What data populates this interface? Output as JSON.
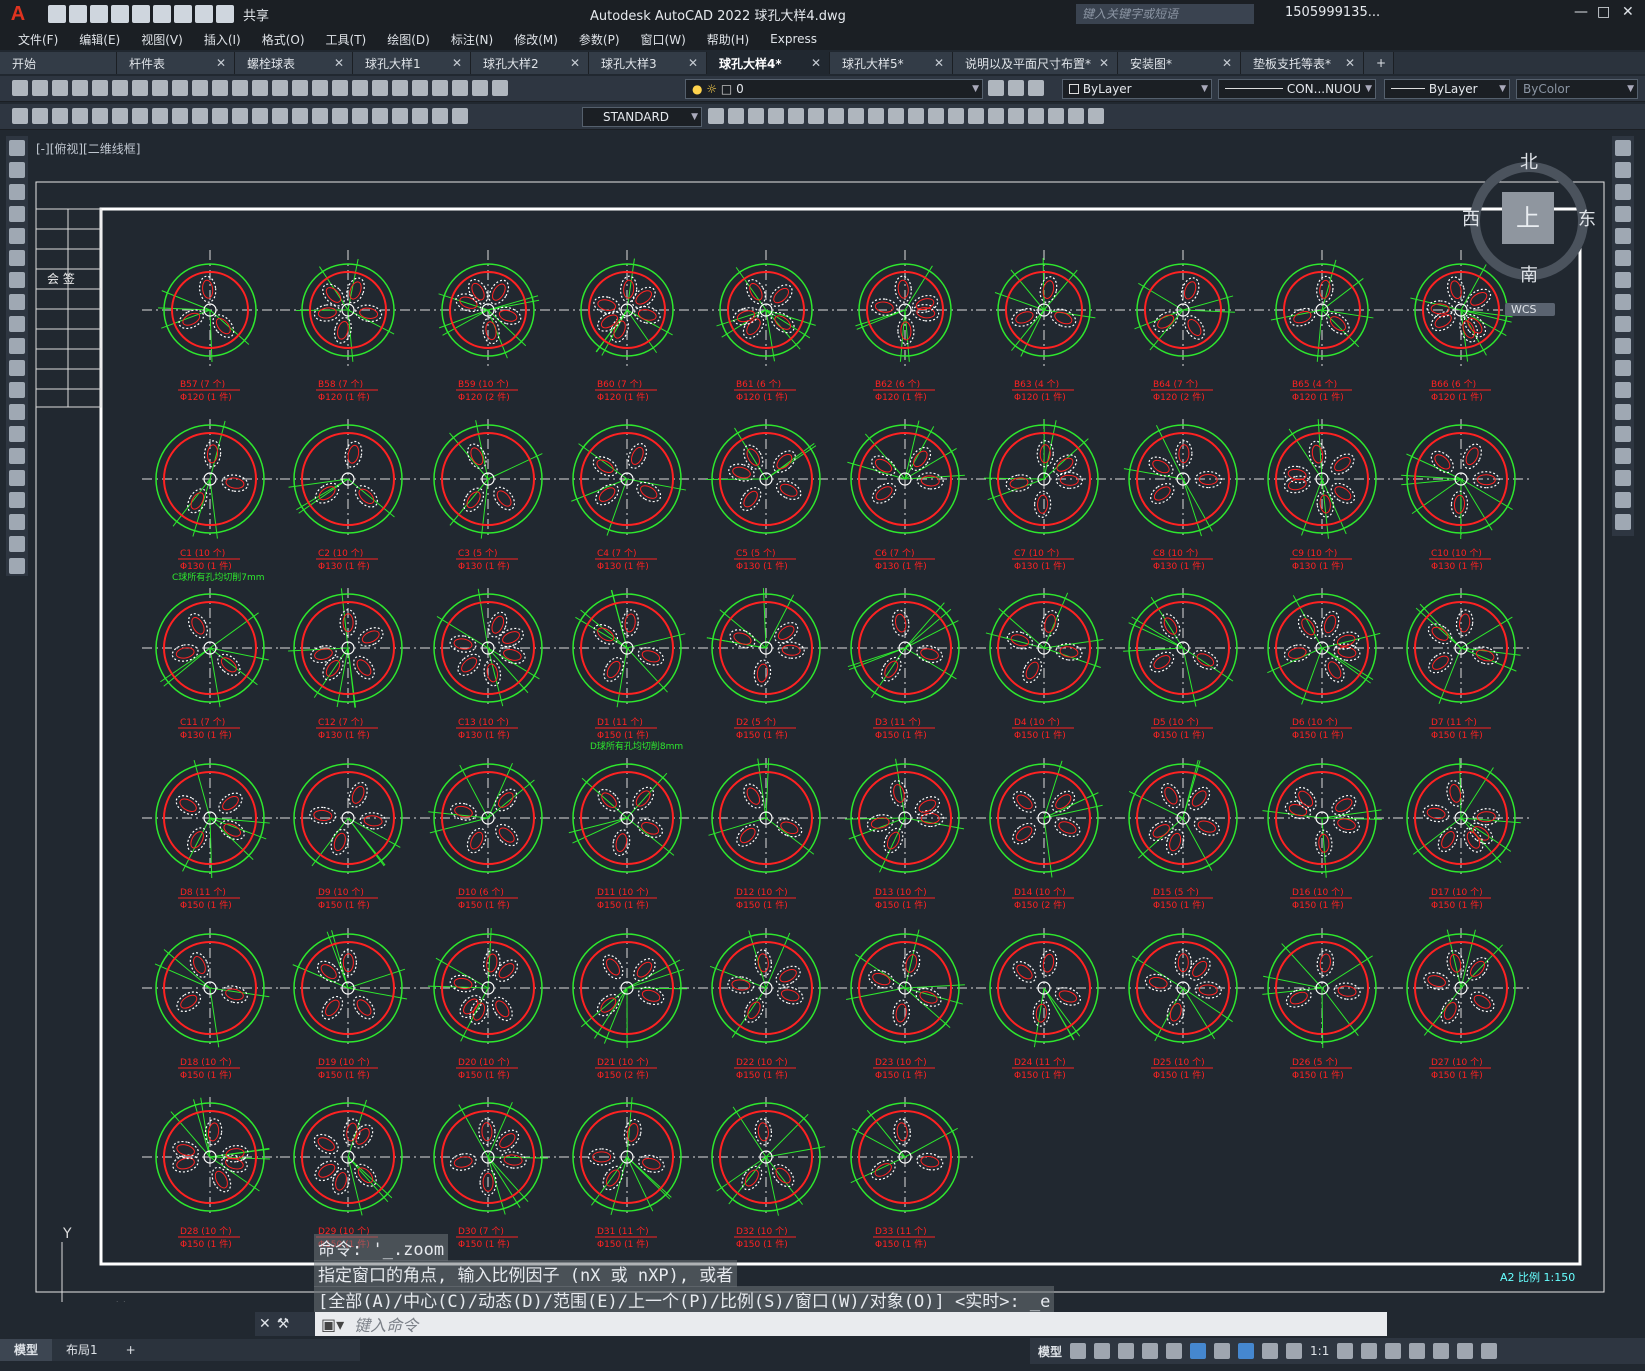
{
  "app": {
    "title": "Autodesk AutoCAD 2022    球孔大样4.dwg",
    "search_placeholder": "键入关键字或短语",
    "user": "1505999135...",
    "share": "共享"
  },
  "menu": [
    "文件(F)",
    "编辑(E)",
    "视图(V)",
    "插入(I)",
    "格式(O)",
    "工具(T)",
    "绘图(D)",
    "标注(N)",
    "修改(M)",
    "参数(P)",
    "窗口(W)",
    "帮助(H)",
    "Express"
  ],
  "tabs": [
    {
      "label": "开始",
      "active": false
    },
    {
      "label": "杆件表",
      "active": false
    },
    {
      "label": "螺栓球表",
      "active": false
    },
    {
      "label": "球孔大样1",
      "active": false
    },
    {
      "label": "球孔大样2",
      "active": false
    },
    {
      "label": "球孔大样3",
      "active": false
    },
    {
      "label": "球孔大样4*",
      "active": true
    },
    {
      "label": "球孔大样5*",
      "active": false
    },
    {
      "label": "说明以及平面尺寸布置*",
      "active": false
    },
    {
      "label": "安装图*",
      "active": false
    },
    {
      "label": "垫板支托等表*",
      "active": false
    }
  ],
  "toolbar": {
    "layer": "0",
    "color": "ByLayer",
    "linetype": "CON...NUOU",
    "lineweight": "ByLayer",
    "plotstyle": "ByColor",
    "textstyle": "STANDARD"
  },
  "view_label": "[-][俯视][二维线框]",
  "title_block_label": "会 签",
  "viewcube": {
    "north": "北",
    "south": "南",
    "west": "西",
    "east": "东",
    "face": "上",
    "wcs": "WCS"
  },
  "colors": {
    "ring": "#ff2222",
    "dimension": "#2ee82e",
    "holes": "#ffffff",
    "axis": "#dddddd"
  },
  "ball_labels": [
    [
      "B57 (7 个)",
      "B58 (7 个)",
      "B59 (10 个)",
      "B60 (7 个)",
      "B61 (6 个)",
      "B62 (6 个)",
      "B63 (4 个)",
      "B64 (7 个)",
      "B65 (4 个)",
      "B66 (6 个)"
    ],
    [
      "C1 (10 个)",
      "C2 (10 个)",
      "C3 (5 个)",
      "C4 (7 个)",
      "C5 (5 个)",
      "C6 (7 个)",
      "C7 (10 个)",
      "C8 (10 个)",
      "C9 (10 个)",
      "C10 (10 个)"
    ],
    [
      "C11 (7 个)",
      "C12 (7 个)",
      "C13 (10 个)",
      "D1 (11 个)",
      "D2 (5 个)",
      "D3 (11 个)",
      "D4 (10 个)",
      "D5 (10 个)",
      "D6 (10 个)",
      "D7 (11 个)"
    ],
    [
      "D8 (11 个)",
      "D9 (10 个)",
      "D10 (6 个)",
      "D11 (10 个)",
      "D12 (10 个)",
      "D13 (10 个)",
      "D14 (10 个)",
      "D15 (5 个)",
      "D16 (10 个)",
      "D17 (10 个)"
    ],
    [
      "D18 (10 个)",
      "D19 (10 个)",
      "D20 (10 个)",
      "D21 (10 个)",
      "D22 (10 个)",
      "D23 (10 个)",
      "D24 (11 个)",
      "D25 (10 个)",
      "D26 (5 个)",
      "D27 (10 个)"
    ],
    [
      "D28 (10 个)",
      "D29 (10 个)",
      "D30 (7 个)",
      "D31 (11 个)",
      "D32 (10 个)",
      "D33 (11 个)"
    ]
  ],
  "ball_sub_labels": [
    [
      "Φ120 (1 件)",
      "Φ120 (1 件)",
      "Φ120 (2 件)",
      "Φ120 (1 件)",
      "Φ120 (1 件)",
      "Φ120 (1 件)",
      "Φ120 (1 件)",
      "Φ120 (2 件)",
      "Φ120 (1 件)",
      "Φ120 (1 件)"
    ],
    [
      "Φ130 (1 件)",
      "Φ130 (1 件)",
      "Φ130 (1 件)",
      "Φ130 (1 件)",
      "Φ130 (1 件)",
      "Φ130 (1 件)",
      "Φ130 (1 件)",
      "Φ130 (1 件)",
      "Φ130 (1 件)",
      "Φ130 (1 件)"
    ],
    [
      "Φ130 (1 件)",
      "Φ130 (1 件)",
      "Φ130 (1 件)",
      "Φ150 (1 件)",
      "Φ150 (1 件)",
      "Φ150 (1 件)",
      "Φ150 (1 件)",
      "Φ150 (1 件)",
      "Φ150 (1 件)",
      "Φ150 (1 件)"
    ],
    [
      "Φ150 (1 件)",
      "Φ150 (1 件)",
      "Φ150 (1 件)",
      "Φ150 (1 件)",
      "Φ150 (1 件)",
      "Φ150 (1 件)",
      "Φ150 (2 件)",
      "Φ150 (1 件)",
      "Φ150 (1 件)",
      "Φ150 (1 件)"
    ],
    [
      "Φ150 (1 件)",
      "Φ150 (1 件)",
      "Φ150 (1 件)",
      "Φ150 (2 件)",
      "Φ150 (1 件)",
      "Φ150 (1 件)",
      "Φ150 (1 件)",
      "Φ150 (1 件)",
      "Φ150 (1 件)",
      "Φ150 (1 件)"
    ],
    [
      "Φ150 (1 件)",
      "Φ150 (1 件)",
      "Φ150 (1 件)",
      "Φ150 (1 件)",
      "Φ150 (1 件)",
      "Φ150 (1 件)"
    ]
  ],
  "notes": {
    "c_note": "C球所有孔均切削7mm",
    "d_note": "D球所有孔均切削8mm"
  },
  "scale_note": "A2 比例 1:150",
  "command": {
    "history": [
      "命令: '_.zoom",
      "指定窗口的角点, 输入比例因子 (nX 或 nXP), 或者",
      "[全部(A)/中心(C)/动态(D)/范围(E)/上一个(P)/比例(S)/窗口(W)/对象(O)] <实时>: _e"
    ],
    "placeholder": "键入命令"
  },
  "layout_tabs": [
    "模型",
    "布局1"
  ],
  "status": {
    "model": "模型",
    "scale": "1:1"
  }
}
